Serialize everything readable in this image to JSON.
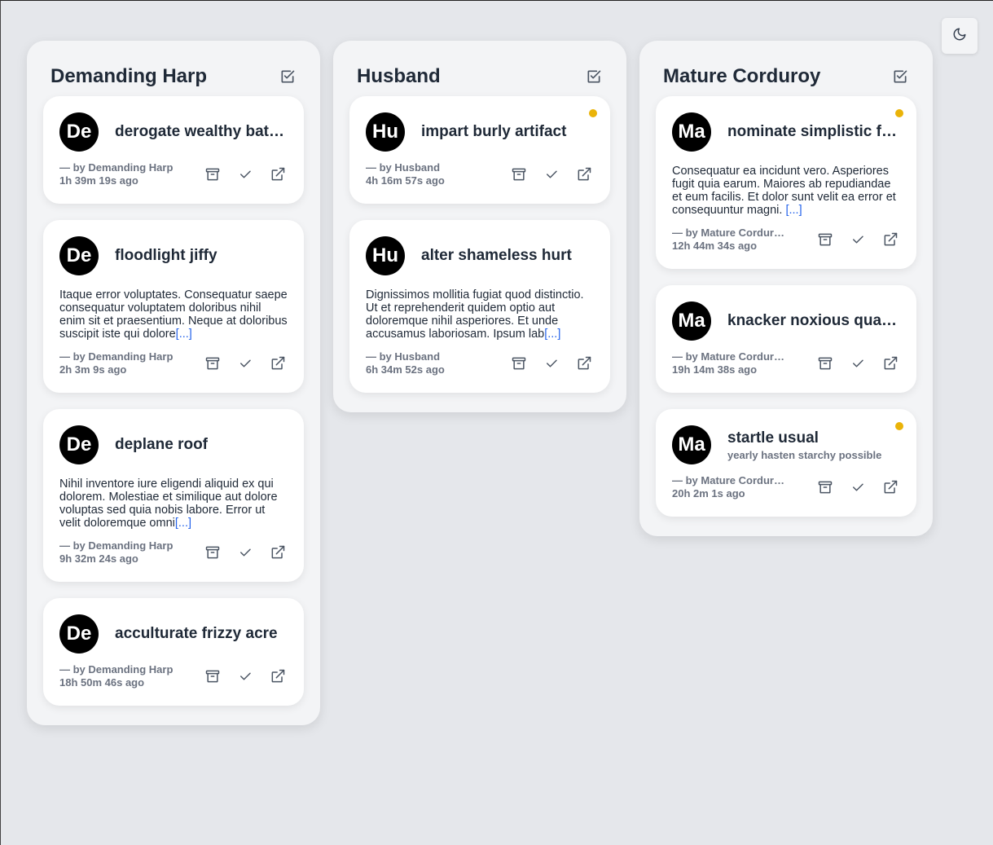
{
  "colors": {
    "accent_dot": "#eab308",
    "link": "#2563eb",
    "avatar_bg": "#000000"
  },
  "theme_toggle": {
    "icon": "moon-icon"
  },
  "columns": [
    {
      "title": "Demanding Harp",
      "cards": [
        {
          "avatar": "De",
          "title": "derogate wealthy bat…",
          "body": "",
          "more": "",
          "author": "— by Demanding Harp",
          "time": "1h 39m 19s ago"
        },
        {
          "avatar": "De",
          "title": "floodlight jiffy",
          "body": "Itaque error voluptates. Consequatur saepe consequatur voluptatem doloribus nihil enim sit et praesentium. Neque at doloribus suscipit iste qui dolore",
          "more": "[...]",
          "author": "— by Demanding Harp",
          "time": "2h 3m 9s ago"
        },
        {
          "avatar": "De",
          "title": "deplane roof",
          "body": "Nihil inventore iure eligendi aliquid ex qui dolorem. Molestiae et similique aut dolore voluptas sed quia nobis labore. Error ut velit doloremque omni",
          "more": "[...]",
          "author": "— by Demanding Harp",
          "time": "9h 32m 24s ago"
        },
        {
          "avatar": "De",
          "title": "acculturate frizzy acre",
          "body": "",
          "more": "",
          "author": "— by Demanding Harp",
          "time": "18h 50m 46s ago"
        }
      ]
    },
    {
      "title": "Husband",
      "cards": [
        {
          "avatar": "Hu",
          "title": "impart burly artifact",
          "dot": true,
          "body": "",
          "more": "",
          "author": "— by Husband",
          "time": "4h 16m 57s ago"
        },
        {
          "avatar": "Hu",
          "title": "alter shameless hurt",
          "body": "Dignissimos mollitia fugiat quod distinctio. Ut et reprehenderit quidem optio aut doloremque nihil asperiores. Et unde accusamus laboriosam. Ipsum lab",
          "more": "[...]",
          "author": "— by Husband",
          "time": "6h 34m 52s ago"
        }
      ]
    },
    {
      "title": "Mature Corduroy",
      "cards": [
        {
          "avatar": "Ma",
          "title": "nominate simplistic f…",
          "dot": true,
          "body": "Consequatur ea incidunt vero. Asperiores fugit quia earum. Maiores ab repudiandae et eum facilis. Et dolor sunt velit ea error et consequuntur magni. ",
          "more": "[...]",
          "author": "— by Mature Cordur…",
          "time": "12h 44m 34s ago"
        },
        {
          "avatar": "Ma",
          "title": "knacker noxious quan…",
          "body": "",
          "more": "",
          "author": "— by Mature Cordur…",
          "time": "19h 14m 38s ago"
        },
        {
          "avatar": "Ma",
          "title": "startle usual",
          "subtitle": "yearly hasten starchy possible",
          "dot": true,
          "body": "",
          "more": "",
          "author": "— by Mature Cordur…",
          "time": "20h 2m 1s ago"
        }
      ]
    }
  ]
}
